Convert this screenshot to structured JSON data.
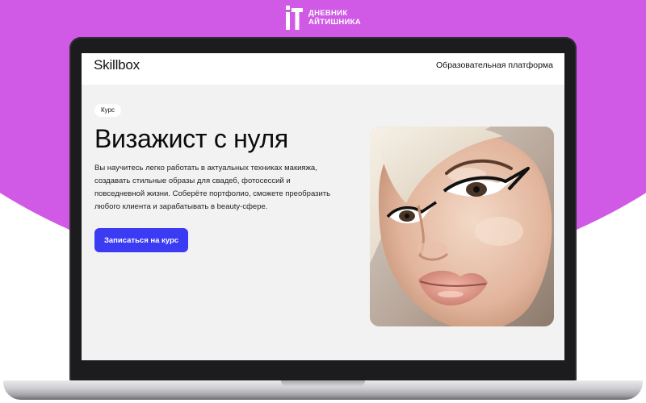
{
  "watermark": {
    "brand_line1": "ДНЕВНИК",
    "brand_line2": "АЙТИШНИКА",
    "background_color": "#d05ae6"
  },
  "site": {
    "logo": "Skillbox",
    "tagline": "Образовательная платформа"
  },
  "hero": {
    "badge": "Курс",
    "title": "Визажист с нуля",
    "description": "Вы научитесь легко работать в актуальных техниках макияжа, создавать стильные образы для свадеб, фотосессий и повседневной жизни. Соберёте портфолио, сможете преобразить любого клиента и зарабатывать в beauty-сфере.",
    "cta_label": "Записаться на курс",
    "cta_color": "#3b3bf4",
    "image": "makeup-model-portrait"
  }
}
